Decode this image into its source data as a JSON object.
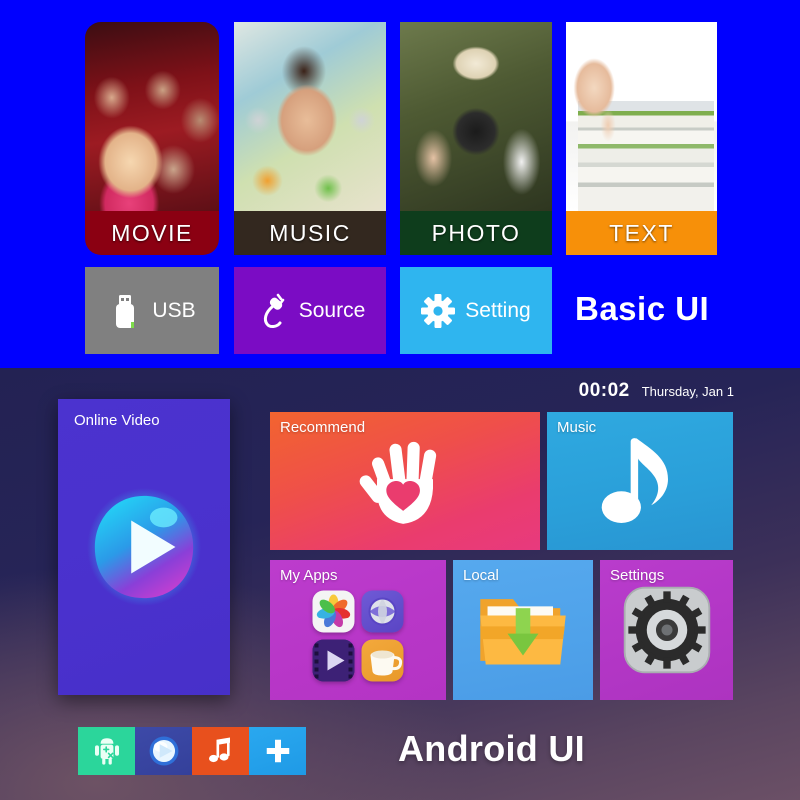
{
  "basic_ui": {
    "title": "Basic UI",
    "background_color": "#0000FF",
    "media_tiles": [
      {
        "label": "MOVIE",
        "label_color": "#8B0012",
        "icon": "movie-thumbnail",
        "selected": true
      },
      {
        "label": "MUSIC",
        "label_color": "#33281F",
        "icon": "music-thumbnail",
        "selected": false
      },
      {
        "label": "PHOTO",
        "label_color": "#0E3D1C",
        "icon": "photo-thumbnail",
        "selected": false
      },
      {
        "label": "TEXT",
        "label_color": "#F79009",
        "icon": "text-thumbnail",
        "selected": false
      }
    ],
    "action_tiles": [
      {
        "label": "USB",
        "icon": "usb-drive-icon",
        "color": "#808080"
      },
      {
        "label": "Source",
        "icon": "power-plug-icon",
        "color": "#7B0CC4"
      },
      {
        "label": "Setting",
        "icon": "gear-icon",
        "color": "#2FB5EF"
      }
    ]
  },
  "android_ui": {
    "title": "Android UI",
    "status_bar": {
      "time": "00:02",
      "date": "Thursday, Jan 1"
    },
    "online_video": {
      "label": "Online Video",
      "icon": "play-button-icon",
      "color": "#4B33CF"
    },
    "tiles": [
      {
        "label": "Recommend",
        "icon": "hand-heart-icon",
        "color": "#EA3C6E"
      },
      {
        "label": "Music",
        "icon": "music-note-icon",
        "color": "#2FA9E0"
      },
      {
        "label": "My Apps",
        "icon": "app-grid-icon",
        "color": "#BC3CCD"
      },
      {
        "label": "Local",
        "icon": "folder-download-icon",
        "color": "#56A9EE"
      },
      {
        "label": "Settings",
        "icon": "gear-icon",
        "color": "#B93CCC"
      }
    ],
    "my_apps_icons": [
      {
        "name": "photos-icon"
      },
      {
        "name": "browser-globe-icon"
      },
      {
        "name": "video-player-icon"
      },
      {
        "name": "coffee-cup-icon"
      }
    ],
    "taskbar": [
      {
        "icon": "android-apps-icon",
        "color": "#2BD69B"
      },
      {
        "icon": "media-player-icon",
        "color": "#3D4AA8"
      },
      {
        "icon": "music-note-icon",
        "color": "#E8501D"
      },
      {
        "icon": "add-plus-icon",
        "color": "#2AA8EF"
      }
    ]
  }
}
